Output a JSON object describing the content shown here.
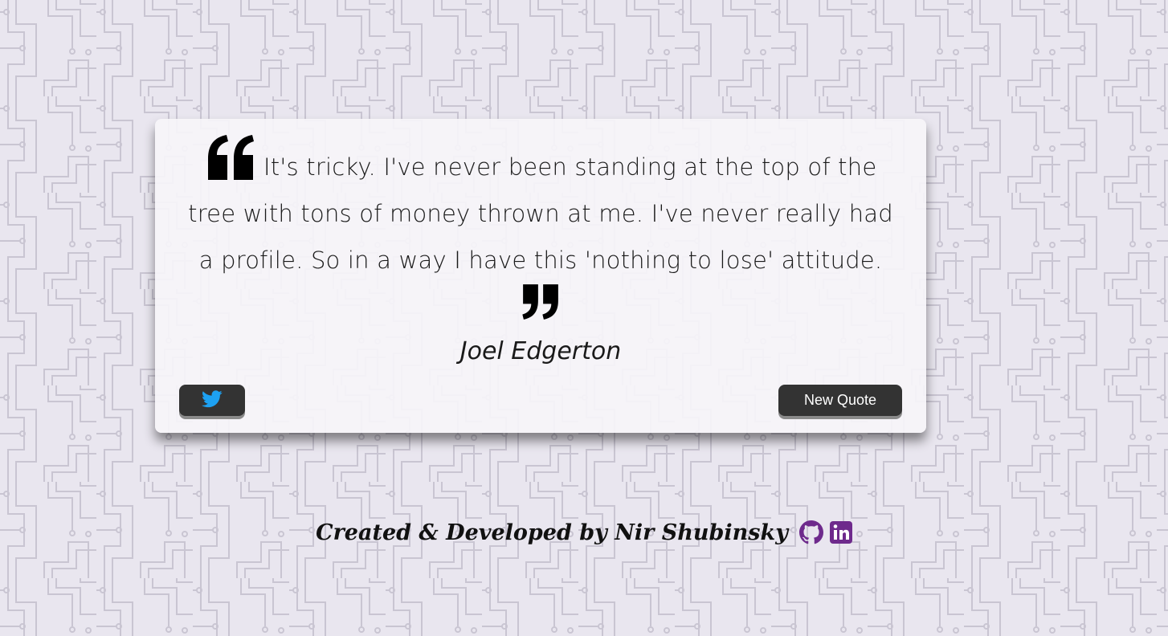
{
  "quote": {
    "text": "It's tricky. I've never been standing at the top of the tree with tons of money thrown at me. I've never really had a profile. So in a way I have this 'nothing to lose' attitude.",
    "author": "Joel Edgerton",
    "open_mark_icon": "quote-left-icon",
    "close_mark_icon": "quote-right-icon"
  },
  "buttons": {
    "twitter_icon": "twitter-icon",
    "new_quote_label": "New Quote"
  },
  "footer": {
    "credit": "Created & Developed by Nir Shubinsky",
    "github_icon": "github-icon",
    "linkedin_icon": "linkedin-icon"
  },
  "colors": {
    "background": "#e9e6ef",
    "circuit_lines": "#c9c5d2",
    "card": "#f6f4f9",
    "button": "#333333",
    "twitter_blue": "#1da1f2",
    "brand_purple": "#6e2a8c"
  }
}
